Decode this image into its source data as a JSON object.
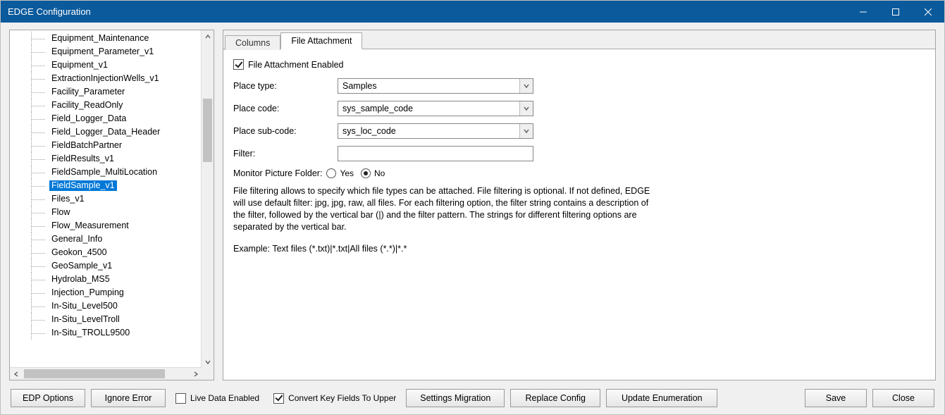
{
  "window": {
    "title": "EDGE Configuration"
  },
  "tree": {
    "items": [
      "Equipment_Maintenance",
      "Equipment_Parameter_v1",
      "Equipment_v1",
      "ExtractionInjectionWells_v1",
      "Facility_Parameter",
      "Facility_ReadOnly",
      "Field_Logger_Data",
      "Field_Logger_Data_Header",
      "FieldBatchPartner",
      "FieldResults_v1",
      "FieldSample_MultiLocation",
      "FieldSample_v1",
      "Files_v1",
      "Flow",
      "Flow_Measurement",
      "General_Info",
      "Geokon_4500",
      "GeoSample_v1",
      "Hydrolab_MS5",
      "Injection_Pumping",
      "In-Situ_Level500",
      "In-Situ_LevelTroll",
      "In-Situ_TROLL9500"
    ],
    "selected_index": 11
  },
  "tabs": {
    "items": [
      "Columns",
      "File Attachment"
    ],
    "active_index": 1
  },
  "form": {
    "enable_label": "File Attachment Enabled",
    "enable_checked": true,
    "place_type_label": "Place type:",
    "place_type_value": "Samples",
    "place_code_label": "Place code:",
    "place_code_value": "sys_sample_code",
    "place_subcode_label": "Place sub-code:",
    "place_subcode_value": "sys_loc_code",
    "filter_label": "Filter:",
    "filter_value": "",
    "monitor_label": "Monitor Picture Folder:",
    "monitor_yes": "Yes",
    "monitor_no": "No",
    "monitor_value": "No",
    "note1": "File filtering allows to specify which file types can be attached. File filtering is optional. If not defined, EDGE will use default filter: jpg, jpg, raw, all files. For each filtering option, the filter string contains a description of the filter, followed by the vertical bar (|) and the filter pattern. The strings for different filtering options are separated by the vertical bar.",
    "note2": "Example:  Text files (*.txt)|*.txt|All files (*.*)|*.*"
  },
  "bottom": {
    "edp_options": "EDP Options",
    "ignore_error": "Ignore Error",
    "live_data": "Live Data Enabled",
    "live_data_checked": false,
    "convert_upper": "Convert Key Fields To Upper",
    "convert_upper_checked": true,
    "settings_migration": "Settings Migration",
    "replace_config": "Replace Config",
    "update_enum": "Update Enumeration",
    "save": "Save",
    "close": "Close"
  }
}
